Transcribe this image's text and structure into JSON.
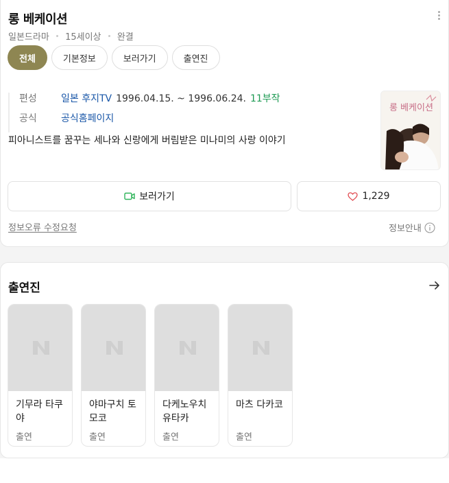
{
  "header": {
    "title": "롱 베케이션",
    "meta": [
      "일본드라마",
      "15세이상",
      "완결"
    ]
  },
  "tabs": [
    "전체",
    "기본정보",
    "보러가기",
    "출연진"
  ],
  "info": {
    "broadcast_label": "편성",
    "network": "일본 후지TV",
    "dates": "1996.04.15. ~ 1996.06.24.",
    "episodes": "11부작",
    "official_label": "공식",
    "official_link": "공식홈페이지"
  },
  "synopsis": "피아니스트를 꿈꾸는 세나와 신랑에게 버림받은 미나미의 사랑 이야기",
  "poster": {
    "title_text": "롱 베케이션"
  },
  "actions": {
    "watch_label": "보러가기",
    "like_count": "1,229"
  },
  "footer": {
    "report_link": "정보오류 수정요청",
    "guide_label": "정보안내"
  },
  "cast": {
    "title": "출연진",
    "placeholder_letter": "N",
    "items": [
      {
        "name": "기무라 타쿠야",
        "role": "출연"
      },
      {
        "name": "야마구치 토모코",
        "role": "출연"
      },
      {
        "name": "다케노우치 유타카",
        "role": "출연"
      },
      {
        "name": "마츠 다카코",
        "role": "출연"
      }
    ]
  },
  "colors": {
    "active_tab": "#8e8652",
    "link": "#1a57a8",
    "episodes": "#1d9a53",
    "watch_icon": "#2fb45a",
    "heart_icon": "#e0484e"
  },
  "icons": {
    "more": "more-vertical-icon",
    "watch": "video-camera-icon",
    "like": "heart-icon",
    "guide": "info-circle-icon",
    "cast_more": "arrow-right-icon"
  }
}
